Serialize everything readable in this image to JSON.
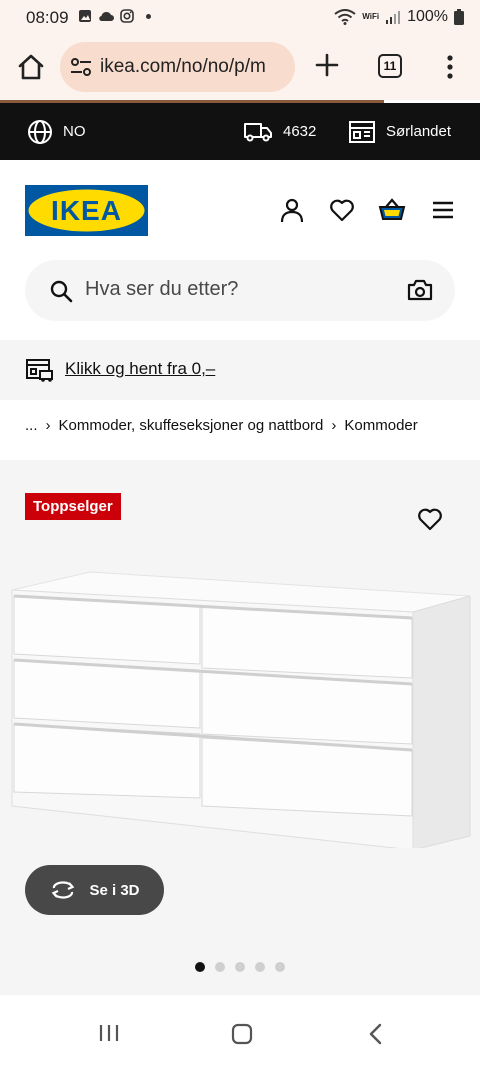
{
  "status": {
    "time": "08:09",
    "battery": "100%",
    "wifi_label": "WiFi"
  },
  "browser": {
    "url": "ikea.com/no/no/p/m",
    "tabs_count": "11"
  },
  "topbar": {
    "language": "NO",
    "postal_code": "4632",
    "store": "Sørlandet"
  },
  "header": {
    "logo_text": "IKEA"
  },
  "search": {
    "placeholder": "Hva ser du etter?"
  },
  "banner": {
    "text": "Klikk og hent fra 0,–"
  },
  "breadcrumb": {
    "ellipsis": "...",
    "items": [
      "Kommoder, skuffeseksjoner og nattbord",
      "Kommoder"
    ]
  },
  "product": {
    "badge": "Toppselger",
    "view_3d_label": "Se i 3D",
    "image_count": 5,
    "active_image": 1
  },
  "colors": {
    "ikea_blue": "#0058a3",
    "ikea_yellow": "#ffdb00",
    "badge_red": "#cc0008",
    "top_bar": "#111111"
  }
}
